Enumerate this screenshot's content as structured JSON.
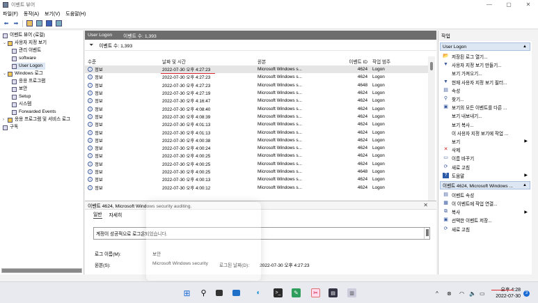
{
  "window": {
    "title": "이벤트 뷰어",
    "controls": [
      "—",
      "▢",
      "✕"
    ]
  },
  "menu": [
    "파일(F)",
    "동작(A)",
    "보기(V)",
    "도움말(H)"
  ],
  "tree": {
    "items": [
      {
        "label": "이벤트 뷰어 (로컬)",
        "expander": "",
        "icon": "event-viewer-icon"
      },
      {
        "label": "사용자 지정 보기",
        "expander": "⌄",
        "icon": "folder-icon"
      },
      {
        "label": "관리 이벤트",
        "expander": "",
        "icon": "filter-icon"
      },
      {
        "label": "software",
        "expander": "",
        "icon": "filter-icon"
      },
      {
        "label": "User Logon",
        "expander": "",
        "icon": "filter-icon",
        "selected": true
      },
      {
        "label": "Windows 로그",
        "expander": "⌄",
        "icon": "folder-icon"
      },
      {
        "label": "응용 프로그램",
        "expander": "",
        "icon": "log-icon"
      },
      {
        "label": "보안",
        "expander": "",
        "icon": "log-icon"
      },
      {
        "label": "Setup",
        "expander": "",
        "icon": "log-icon"
      },
      {
        "label": "시스템",
        "expander": "",
        "icon": "log-icon"
      },
      {
        "label": "Forwarded Events",
        "expander": "",
        "icon": "log-icon"
      },
      {
        "label": "응용 프로그램 및 서비스 로그",
        "expander": "›",
        "icon": "folder-icon"
      },
      {
        "label": "구독",
        "expander": "",
        "icon": "subscription-icon"
      }
    ]
  },
  "center": {
    "header_title": "User Logon",
    "header_count": "이벤트 수: 1,393",
    "filter_text": "이벤트 수: 1,393",
    "columns": {
      "level": "수준",
      "date": "날짜 및 시간",
      "source": "원본",
      "id": "이벤트 ID",
      "category": "작업 범주"
    },
    "rows": [
      {
        "level": "정보",
        "date": "2022-07-30 오후 4:27:23",
        "source": "Microsoft Windows s...",
        "id": "4624",
        "category": "Logon"
      },
      {
        "level": "정보",
        "date": "2022-07-30 오후 4:27:23",
        "source": "Microsoft Windows s...",
        "id": "4624",
        "category": "Logon"
      },
      {
        "level": "정보",
        "date": "2022-07-30 오후 4:27:23",
        "source": "Microsoft Windows s...",
        "id": "4648",
        "category": "Logon"
      },
      {
        "level": "정보",
        "date": "2022-07-30 오후 4:27:19",
        "source": "Microsoft Windows s...",
        "id": "4624",
        "category": "Logon"
      },
      {
        "level": "정보",
        "date": "2022-07-30 오후 4:16:47",
        "source": "Microsoft Windows s...",
        "id": "4624",
        "category": "Logon"
      },
      {
        "level": "정보",
        "date": "2022-07-30 오후 4:08:40",
        "source": "Microsoft Windows s...",
        "id": "4624",
        "category": "Logon"
      },
      {
        "level": "정보",
        "date": "2022-07-30 오후 4:08:39",
        "source": "Microsoft Windows s...",
        "id": "4624",
        "category": "Logon"
      },
      {
        "level": "정보",
        "date": "2022-07-30 오후 4:01:13",
        "source": "Microsoft Windows s...",
        "id": "4624",
        "category": "Logon"
      },
      {
        "level": "정보",
        "date": "2022-07-30 오후 4:01:13",
        "source": "Microsoft Windows s...",
        "id": "4624",
        "category": "Logon"
      },
      {
        "level": "정보",
        "date": "2022-07-30 오후 4:00:38",
        "source": "Microsoft Windows s...",
        "id": "4624",
        "category": "Logon"
      },
      {
        "level": "정보",
        "date": "2022-07-30 오후 4:00:24",
        "source": "Microsoft Windows s...",
        "id": "4624",
        "category": "Logon"
      },
      {
        "level": "정보",
        "date": "2022-07-30 오후 4:00:25",
        "source": "Microsoft Windows s...",
        "id": "4624",
        "category": "Logon"
      },
      {
        "level": "정보",
        "date": "2022-07-30 오후 4:00:25",
        "source": "Microsoft Windows s...",
        "id": "4624",
        "category": "Logon"
      },
      {
        "level": "정보",
        "date": "2022-07-30 오후 4:00:25",
        "source": "Microsoft Windows s...",
        "id": "4648",
        "category": "Logon"
      },
      {
        "level": "정보",
        "date": "2022-07-30 오후 4:00:13",
        "source": "Microsoft Windows s...",
        "id": "4624",
        "category": "Logon"
      },
      {
        "level": "정보",
        "date": "2022-07-30 오후 4:00:12",
        "source": "Microsoft Windows s...",
        "id": "4624",
        "category": "Logon"
      }
    ]
  },
  "detail": {
    "title": "이벤트 4624, Microsoft Windows security auditing.",
    "tabs": [
      "일반",
      "자세히"
    ],
    "message": "계정이 성공적으로 로그온되었습니다.",
    "log_name_label": "로그 이름(M):",
    "log_name_value": "보안",
    "source_label": "원본(S):",
    "source_value": "Microsoft Windows security",
    "logged_label": "로그된 날짜(D):",
    "logged_value": "2022-07-30 오후 4:27:23"
  },
  "actions": {
    "title": "작업",
    "section1": "User Logon",
    "items1": [
      {
        "label": "저장된 로그 열기...",
        "icon": "open-log-icon",
        "glyph": "📂",
        "submenu": false
      },
      {
        "label": "사용자 지정 보기 만들기...",
        "icon": "create-view-icon",
        "glyph": "▼",
        "submenu": false
      },
      {
        "label": "보기 가져오기...",
        "icon": "",
        "glyph": "",
        "submenu": false
      },
      {
        "label": "현재 사용자 지정 보기 필터...",
        "icon": "filter-icon",
        "glyph": "▼",
        "submenu": false
      },
      {
        "label": "속성",
        "icon": "properties-icon",
        "glyph": "▤",
        "submenu": false
      },
      {
        "label": "찾기...",
        "icon": "find-icon",
        "glyph": "⚲",
        "submenu": false
      },
      {
        "label": "보기의 모든 이벤트를 다른 ...",
        "icon": "save-icon",
        "glyph": "▣",
        "submenu": false
      },
      {
        "label": "보기 내보내기...",
        "icon": "",
        "glyph": "",
        "submenu": false
      },
      {
        "label": "보기 복사...",
        "icon": "",
        "glyph": "",
        "submenu": false
      },
      {
        "label": "이 사용자 지정 보기에 작업 ...",
        "icon": "",
        "glyph": "",
        "submenu": false
      },
      {
        "label": "보기",
        "icon": "",
        "glyph": "",
        "submenu": true
      },
      {
        "label": "삭제",
        "icon": "delete-icon",
        "glyph": "✕",
        "submenu": false
      },
      {
        "label": "이름 바꾸기",
        "icon": "rename-icon",
        "glyph": "▭",
        "submenu": false
      },
      {
        "label": "새로 고침",
        "icon": "refresh-icon",
        "glyph": "⟳",
        "submenu": false
      },
      {
        "label": "도움말",
        "icon": "help-icon",
        "glyph": "?",
        "submenu": true
      }
    ],
    "section2": "이벤트 4624, Microsoft Windows ...",
    "items2": [
      {
        "label": "이벤트 속성",
        "icon": "event-properties-icon",
        "glyph": "▤",
        "submenu": false
      },
      {
        "label": "이 이벤트에 작업 연결...",
        "icon": "attach-task-icon",
        "glyph": "▦",
        "submenu": false
      },
      {
        "label": "복사",
        "icon": "copy-icon",
        "glyph": "⧉",
        "submenu": true
      },
      {
        "label": "선택한 이벤트 저장...",
        "icon": "save-icon",
        "glyph": "▣",
        "submenu": false
      },
      {
        "label": "새로 고침",
        "icon": "refresh-icon",
        "glyph": "⟳",
        "submenu": false
      }
    ]
  },
  "taskbar": {
    "clock_time": "오후 4:28",
    "clock_date": "2022-07-30",
    "notifications": "3",
    "tray_chevron": "^",
    "colors": {
      "accent": "#1a6ad6",
      "annotation": "#d9272e"
    }
  }
}
